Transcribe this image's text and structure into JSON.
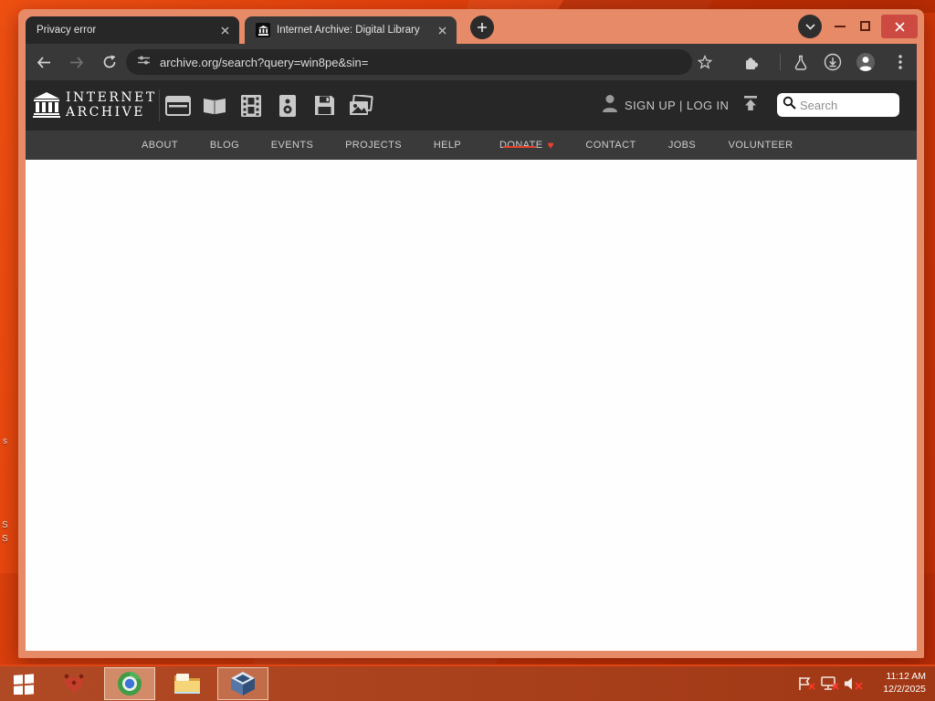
{
  "browser": {
    "tabs": [
      {
        "title": "Privacy error"
      },
      {
        "title": "Internet Archive: Digital Library"
      }
    ],
    "url": "archive.org/search?query=win8pe&sin="
  },
  "archive_header": {
    "brand_line1": "INTERNET",
    "brand_line2": "ARCHIVE",
    "media_types": [
      "web",
      "texts",
      "video",
      "audio",
      "software",
      "images"
    ],
    "account_text": "SIGN UP | LOG IN",
    "search_placeholder": "Search"
  },
  "archive_nav": {
    "items": [
      "ABOUT",
      "BLOG",
      "EVENTS",
      "PROJECTS",
      "HELP",
      "DONATE",
      "CONTACT",
      "JOBS",
      "VOLUNTEER"
    ],
    "donate_heart": "♥"
  },
  "desktop": {
    "icon_fragments": [
      "s",
      "S",
      "S"
    ]
  },
  "taskbar": {
    "clock_time": "11:12 AM",
    "clock_date": "12/2/2025"
  },
  "colors": {
    "frame": "#e78a67",
    "desktop": "#d63a08",
    "close_button": "#cc4a42",
    "donate_heart": "#e8412e"
  }
}
